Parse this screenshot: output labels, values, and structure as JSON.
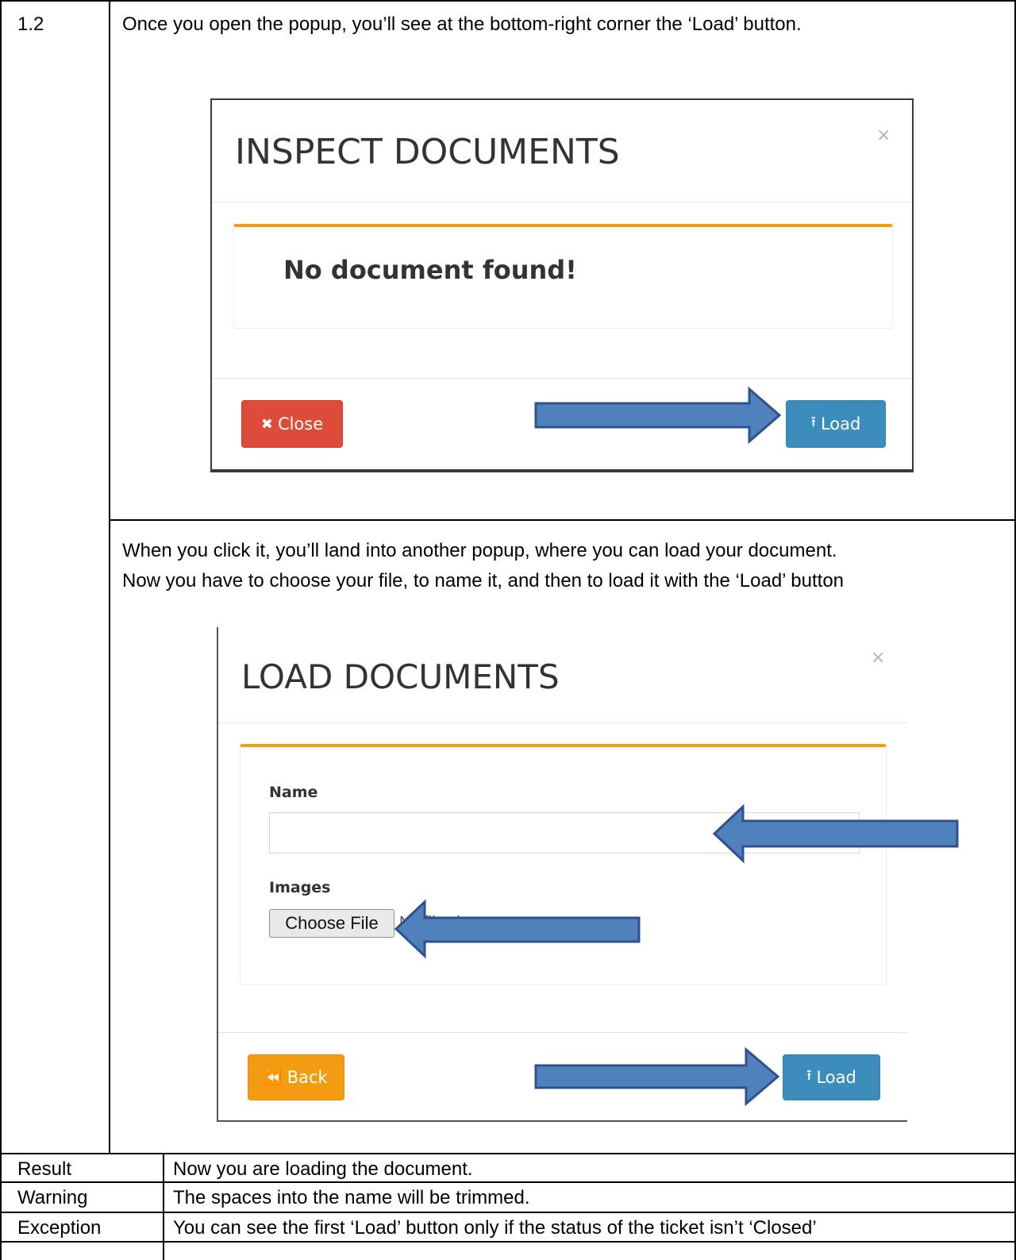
{
  "step": {
    "number": "1.2",
    "intro": "Once you open the popup, you’ll see at the bottom-right corner the ‘Load’ button.",
    "second_line1": "When you click it, you’ll land into another popup, where you can load your document.",
    "second_line2": "Now you have to choose your file, to name it, and then to load it with the ‘Load’ button"
  },
  "inspect_popup": {
    "title": "INSPECT DOCUMENTS",
    "close_glyph": "×",
    "message": "No document found!",
    "close_button": "Close",
    "load_button": "Load"
  },
  "load_popup": {
    "title": "LOAD DOCUMENTS",
    "close_glyph": "×",
    "name_label": "Name",
    "name_value": "",
    "images_label": "Images",
    "choose_file": "Choose File",
    "no_file": "No file chosen",
    "back_button": "Back",
    "load_button": "Load"
  },
  "rows": [
    {
      "label": "Result",
      "text": "Now you are loading the document."
    },
    {
      "label": "Warning",
      "text": "The spaces into the name will be trimmed."
    },
    {
      "label": "Exception",
      "text": "You can see the first ‘Load’ button only if the status of the ticket isn’t ‘Closed’"
    }
  ],
  "colors": {
    "accent_orange": "#f39c12",
    "btn_red": "#dd4b39",
    "btn_blue": "#3c8dbc",
    "arrow_fill": "#4f81bd",
    "arrow_stroke": "#2f528f"
  },
  "icons": [
    "close-x-icon",
    "times-icon",
    "upload-icon",
    "backward-icon",
    "arrow-right",
    "arrow-left"
  ]
}
